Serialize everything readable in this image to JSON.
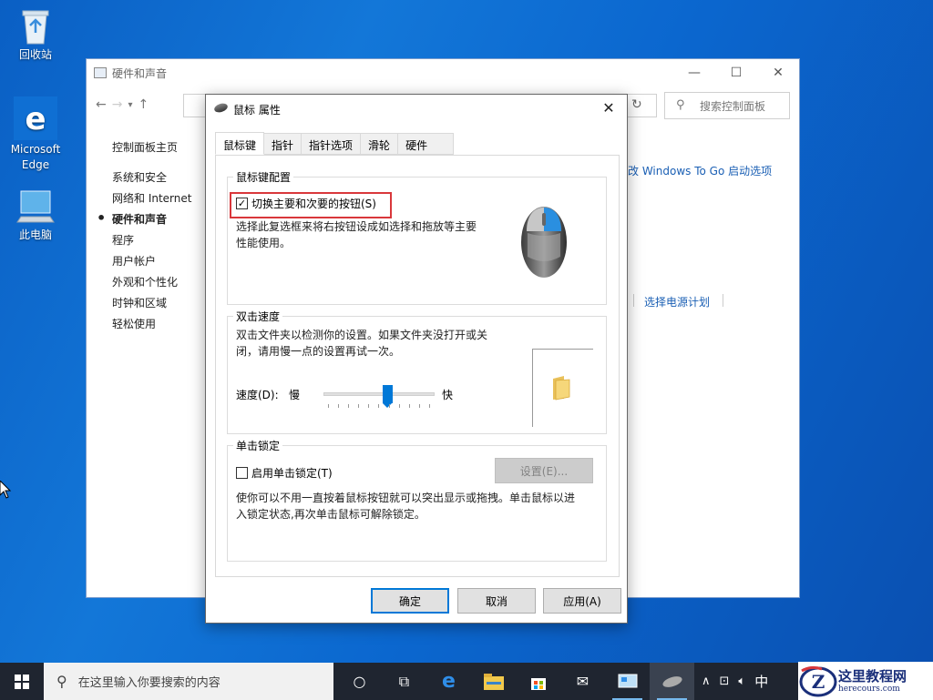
{
  "desktop": {
    "icons": [
      {
        "label": "回收站"
      },
      {
        "label": "Microsoft\nEdge"
      },
      {
        "label": "此电脑"
      }
    ]
  },
  "control_panel": {
    "title": "硬件和声音",
    "search_placeholder": "搜索控制面板",
    "home": "控制面板主页",
    "nav": [
      "系统和安全",
      "网络和 Internet",
      "硬件和声音",
      "程序",
      "用户帐户",
      "外观和个性化",
      "时钟和区域",
      "轻松使用"
    ],
    "active_nav": "硬件和声音",
    "link_windows_to_go": "改 Windows To Go 启动选项",
    "link_power_plan": "选择电源计划"
  },
  "dialog": {
    "title": "鼠标 属性",
    "tabs": [
      "鼠标键",
      "指针",
      "指针选项",
      "滑轮",
      "硬件"
    ],
    "active_tab": "鼠标键",
    "button_config": {
      "group": "鼠标键配置",
      "checkbox_label": "切换主要和次要的按钮(S)",
      "checked": true,
      "description": "选择此复选框来将右按钮设成如选择和拖放等主要\n性能使用。"
    },
    "double_click": {
      "group": "双击速度",
      "description": "双击文件夹以检测你的设置。如果文件夹没打开或关\n闭，请用慢一点的设置再试一次。",
      "speed_label": "速度(D):",
      "slow": "慢",
      "fast": "快",
      "speed_fraction": 0.58
    },
    "click_lock": {
      "group": "单击锁定",
      "checkbox_label": "启用单击锁定(T)",
      "checked": false,
      "settings_button": "设置(E)...",
      "description": "使你可以不用一直按着鼠标按钮就可以突出显示或拖拽。单击鼠标以进\n入锁定状态,再次单击鼠标可解除锁定。"
    },
    "buttons": {
      "ok": "确定",
      "cancel": "取消",
      "apply": "应用(A)"
    }
  },
  "taskbar": {
    "search_placeholder": "在这里输入你要搜索的内容",
    "ime": "中"
  },
  "watermark": {
    "name": "这里教程网",
    "url": "herecours.com"
  },
  "colors": {
    "accent": "#0078d7",
    "highlight_border": "#d9373b",
    "link": "#1a5fb4"
  }
}
